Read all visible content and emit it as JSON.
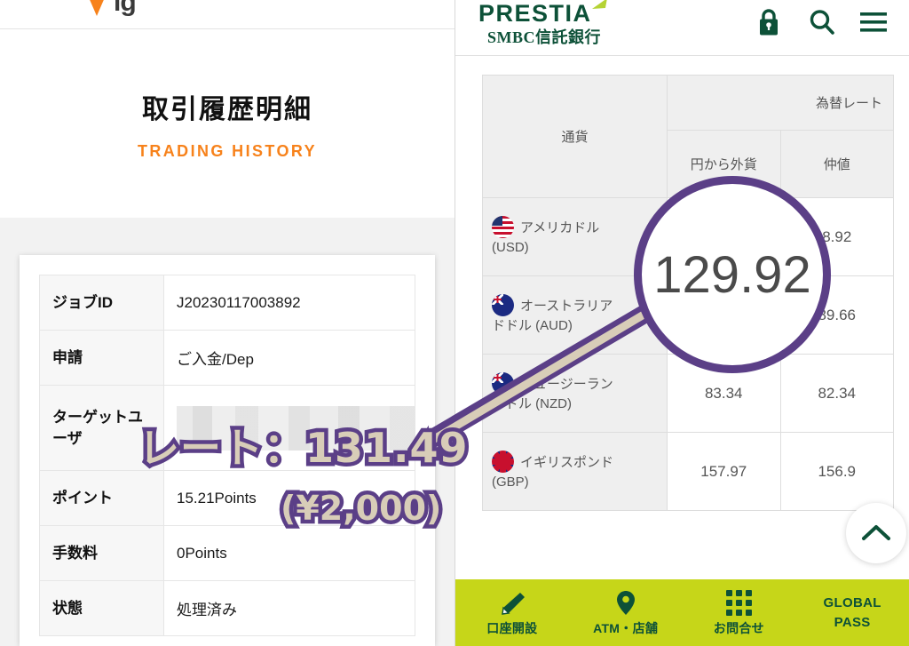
{
  "left_panel": {
    "site_logo_text": "ig",
    "hero": {
      "title_ja": "取引履歴明細",
      "title_en": "TRADING HISTORY"
    },
    "detail_table": {
      "rows": [
        {
          "label": "ジョブID",
          "value": "J20230117003892",
          "masked": false
        },
        {
          "label": "申請",
          "value": "ご入金/Dep",
          "masked": false
        },
        {
          "label": "ターゲットユーザ",
          "value": "",
          "masked": true
        },
        {
          "label": "ポイント",
          "value": "15.21Points",
          "masked": false
        },
        {
          "label": "手数料",
          "value": "0Points",
          "masked": false
        },
        {
          "label": "状態",
          "value": "処理済み",
          "masked": false
        }
      ]
    }
  },
  "right_panel": {
    "header": {
      "brand_wordmark": "PRESTIA",
      "brand_subname": "SMBC信託銀行",
      "icons": [
        {
          "name": "lock-icon",
          "label": "ログイン"
        },
        {
          "name": "search-icon",
          "label": "検索"
        },
        {
          "name": "hamburger-menu-icon",
          "label": "メニュー"
        }
      ]
    },
    "rate_table": {
      "headers": {
        "currency": "通貨",
        "rate_group": "為替レート",
        "from_yen": "円から外貨",
        "mid_rate": "仲値"
      },
      "rows": [
        {
          "flag": "flag-us",
          "name_line1": "アメリカドル",
          "name_line2": "(USD)",
          "from_yen": "",
          "mid_rate": "8.92"
        },
        {
          "flag": "flag-au",
          "name_line1": "オーストラリア",
          "name_line2": "ドドル (AUD)",
          "from_yen": "",
          "mid_rate": "89.66"
        },
        {
          "flag": "flag-nz",
          "name_line1": "ニュージーラン",
          "name_line2": "ドドル (NZD)",
          "from_yen": "83.34",
          "mid_rate": "82.34"
        },
        {
          "flag": "flag-gb",
          "name_line1": "イギリスポンド",
          "name_line2": "(GBP)",
          "from_yen": "157.97",
          "mid_rate": "156.9"
        }
      ]
    },
    "scroll_top_button": {
      "icon": "chevron-up-icon"
    },
    "bottom_nav": [
      {
        "icon": "pen-card-icon",
        "label": "口座開設"
      },
      {
        "icon": "map-pin-icon",
        "label": "ATM・店舗"
      },
      {
        "icon": "dots-grid-icon",
        "label": "お問合せ"
      },
      {
        "icon": "",
        "label": "GLOBAL PASS",
        "label_line1": "GLOBAL",
        "label_line2": "PASS"
      }
    ]
  },
  "annotations": {
    "rate_note": "レート：131.49",
    "amount_note": "(¥2,000)",
    "magnified_value": "129.92",
    "stroke_color": "#5b3f87",
    "fill_color": "#d8cdb8"
  },
  "colors": {
    "orange_accent": "#f7821b",
    "prestia_green": "#0d5138",
    "nav_green": "#c6d619",
    "lime_accent": "#b5d334",
    "annotation_purple": "#5b3f87"
  }
}
